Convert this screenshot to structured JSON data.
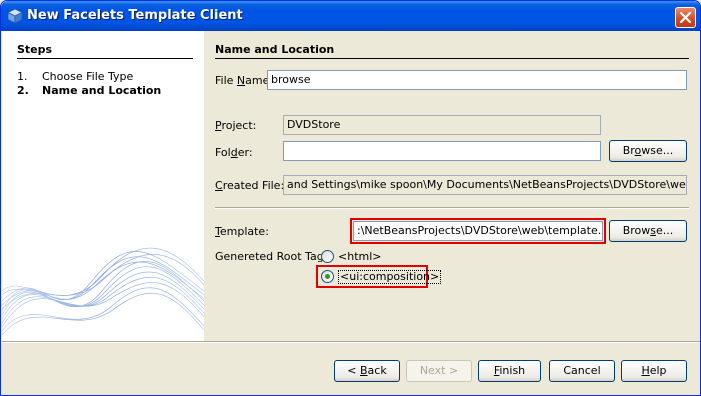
{
  "window": {
    "title": "New Facelets Template Client"
  },
  "steps": {
    "title": "Steps",
    "items": [
      {
        "num": "1.",
        "label": "Choose File Type",
        "active": false
      },
      {
        "num": "2.",
        "label": "Name and Location",
        "active": true
      }
    ]
  },
  "main": {
    "title": "Name and Location",
    "file_name": {
      "label_pre": "File ",
      "label_u": "N",
      "label_post": "ame:",
      "value": "browse"
    },
    "project": {
      "label_u": "P",
      "label_post": "roject:",
      "value": "DVDStore"
    },
    "folder": {
      "label_pre": "Fol",
      "label_u": "d",
      "label_post": "er:",
      "value": "",
      "browse_pre": "Br",
      "browse_u": "o",
      "browse_post": "wse..."
    },
    "created_file": {
      "label_pre": "",
      "label_u": "C",
      "label_post": "reated File:",
      "value": "and Settings\\mike spoon\\My Documents\\NetBeansProjects\\DVDStore\\web\\browse."
    },
    "template": {
      "label_pre": "",
      "label_u": "T",
      "label_post": "emplate:",
      "value": ":\\NetBeansProjects\\DVDStore\\web\\template.xhtml",
      "browse_pre": "Brow",
      "browse_u": "s",
      "browse_post": "e..."
    },
    "root_tag": {
      "label": "Genereted Root Tag:",
      "options": [
        {
          "label": "<html>",
          "selected": false
        },
        {
          "label": "<ui:composition>",
          "selected": true
        }
      ]
    }
  },
  "buttons": {
    "back_pre": "< ",
    "back_u": "B",
    "back_post": "ack",
    "next": "Next >",
    "finish_u": "F",
    "finish_post": "inish",
    "cancel": "Cancel",
    "help_u": "H",
    "help_post": "elp"
  },
  "colors": {
    "highlight": "#e00000",
    "titlebar": "#0054e3"
  }
}
